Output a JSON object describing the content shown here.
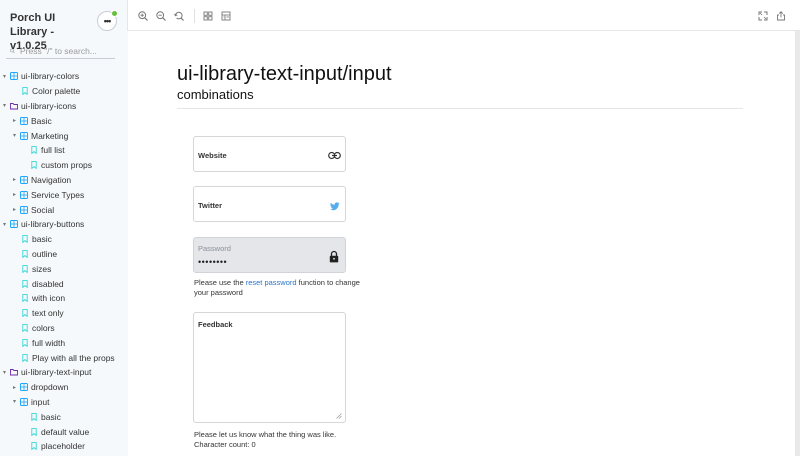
{
  "app": {
    "title": "Porch UI Library - v1.0.25",
    "menu_label": "•••"
  },
  "search": {
    "placeholder": "Press \"/\" to search..."
  },
  "sidebar": {
    "items": [
      {
        "label": "ui-library-colors",
        "type": "component",
        "level": 0,
        "expanded": true
      },
      {
        "label": "Color palette",
        "type": "story",
        "level": 1
      },
      {
        "label": "ui-library-icons",
        "type": "folder",
        "level": 0,
        "expanded": true
      },
      {
        "label": "Basic",
        "type": "component",
        "level": 1,
        "expanded": false
      },
      {
        "label": "Marketing",
        "type": "component",
        "level": 1,
        "expanded": true
      },
      {
        "label": "full list",
        "type": "story",
        "level": 2
      },
      {
        "label": "custom props",
        "type": "story",
        "level": 2
      },
      {
        "label": "Navigation",
        "type": "component",
        "level": 1,
        "expanded": false
      },
      {
        "label": "Service Types",
        "type": "component",
        "level": 1,
        "expanded": false
      },
      {
        "label": "Social",
        "type": "component",
        "level": 1,
        "expanded": false
      },
      {
        "label": "ui-library-buttons",
        "type": "component",
        "level": 0,
        "expanded": true
      },
      {
        "label": "basic",
        "type": "story",
        "level": 1
      },
      {
        "label": "outline",
        "type": "story",
        "level": 1
      },
      {
        "label": "sizes",
        "type": "story",
        "level": 1
      },
      {
        "label": "disabled",
        "type": "story",
        "level": 1
      },
      {
        "label": "with icon",
        "type": "story",
        "level": 1
      },
      {
        "label": "text only",
        "type": "story",
        "level": 1
      },
      {
        "label": "colors",
        "type": "story",
        "level": 1
      },
      {
        "label": "full width",
        "type": "story",
        "level": 1
      },
      {
        "label": "Play with all the props",
        "type": "story",
        "level": 1
      },
      {
        "label": "ui-library-text-input",
        "type": "folder",
        "level": 0,
        "expanded": true
      },
      {
        "label": "dropdown",
        "type": "component",
        "level": 1,
        "expanded": false
      },
      {
        "label": "input",
        "type": "component",
        "level": 1,
        "expanded": true
      },
      {
        "label": "basic",
        "type": "story",
        "level": 2
      },
      {
        "label": "default value",
        "type": "story",
        "level": 2
      },
      {
        "label": "placeholder",
        "type": "story",
        "level": 2
      }
    ]
  },
  "toolbar": {
    "icons": [
      "zoom-in-icon",
      "zoom-out-icon",
      "zoom-reset-icon",
      "grid-icon",
      "measure-icon",
      "fullscreen-icon",
      "share-icon"
    ]
  },
  "story": {
    "title": "ui-library-text-input/input",
    "subtitle": "combinations"
  },
  "fields": {
    "website": {
      "label": "Website",
      "icon": "link-icon"
    },
    "twitter": {
      "label": "Twitter",
      "icon": "twitter-icon"
    },
    "password": {
      "label": "Password",
      "value": "••••••••",
      "icon": "lock-icon",
      "help_before": "Please use the ",
      "help_link": "reset password",
      "help_after": " function to change your password"
    },
    "feedback": {
      "label": "Feedback",
      "help_line1": "Please let us know what the thing was like.",
      "help_line2": "Character count: 0"
    }
  },
  "colors": {
    "accent": "#1ea7fd",
    "link": "#2a75c9",
    "status_dot": "#66bf3c",
    "twitter": "#55acee"
  }
}
